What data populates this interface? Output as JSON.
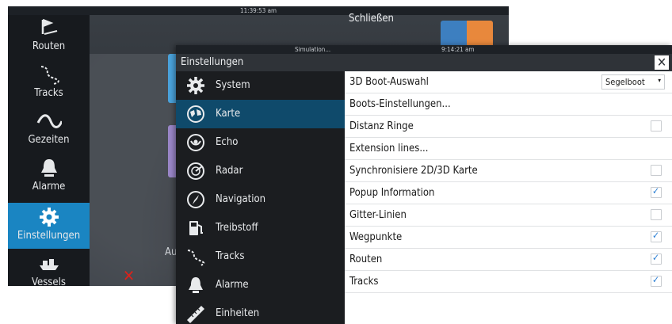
{
  "background": {
    "clock": "11:39:53 am",
    "close_label": "Schließen",
    "partial_text": "Au",
    "sidebar": [
      {
        "label": "Routen",
        "icon": "routes-icon"
      },
      {
        "label": "Tracks",
        "icon": "tracks-icon"
      },
      {
        "label": "Gezeiten",
        "icon": "tides-icon"
      },
      {
        "label": "Alarme",
        "icon": "bell-icon"
      },
      {
        "label": "Einstellungen",
        "icon": "gear-icon",
        "active": true
      },
      {
        "label": "Vessels",
        "icon": "vessels-icon"
      }
    ]
  },
  "dialog": {
    "status_sim": "Simulation...",
    "status_time": "9:14:21 am",
    "title": "Einstellungen",
    "close_glyph": "✕",
    "menu": [
      {
        "label": "System",
        "icon": "gear-icon"
      },
      {
        "label": "Karte",
        "icon": "chart-icon",
        "active": true
      },
      {
        "label": "Echo",
        "icon": "echo-icon"
      },
      {
        "label": "Radar",
        "icon": "radar-icon"
      },
      {
        "label": "Navigation",
        "icon": "compass-icon"
      },
      {
        "label": "Treibstoff",
        "icon": "fuel-icon"
      },
      {
        "label": "Tracks",
        "icon": "tracks-icon"
      },
      {
        "label": "Alarme",
        "icon": "bell-icon"
      },
      {
        "label": "Einheiten",
        "icon": "ruler-icon"
      }
    ],
    "settings": [
      {
        "label": "3D Boot-Auswahl",
        "type": "dropdown",
        "value": "Segelboot"
      },
      {
        "label": "Boots-Einstellungen...",
        "type": "link"
      },
      {
        "label": "Distanz Ringe",
        "type": "checkbox",
        "checked": false
      },
      {
        "label": "Extension lines...",
        "type": "link"
      },
      {
        "label": "Synchronisiere 2D/3D Karte",
        "type": "checkbox",
        "checked": false
      },
      {
        "label": "Popup Information",
        "type": "checkbox",
        "checked": true
      },
      {
        "label": "Gitter-Linien",
        "type": "checkbox",
        "checked": false
      },
      {
        "label": "Wegpunkte",
        "type": "checkbox",
        "checked": true
      },
      {
        "label": "Routen",
        "type": "checkbox",
        "checked": true
      },
      {
        "label": "Tracks",
        "type": "checkbox",
        "checked": true
      }
    ]
  },
  "colors": {
    "active_sidebar": "#1a85c2",
    "active_menu": "#0f4a6b",
    "check_blue": "#2a7fd4",
    "alert_red": "#d8231c"
  }
}
